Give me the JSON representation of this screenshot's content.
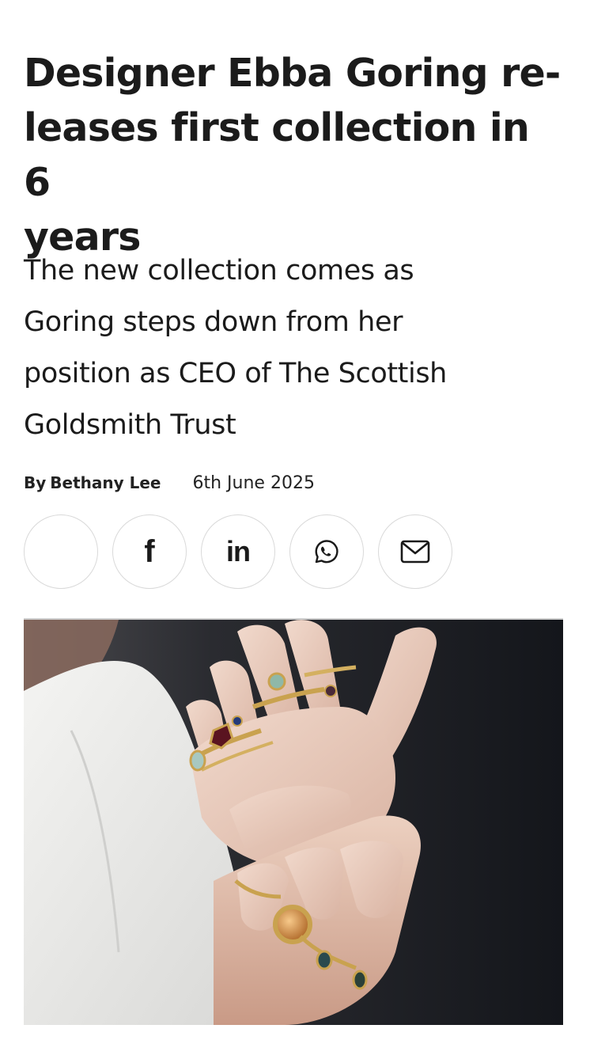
{
  "article": {
    "headline": "Designer Ebba Goring re-leases first collection in 6 years",
    "headline_lines": [
      "Designer Ebba Goring re-",
      "leases first collection in 6",
      "years"
    ],
    "standfirst_lines": [
      "The new collection comes as",
      "Goring steps down from her",
      "position as CEO of The Scottish",
      "Goldsmith Trust"
    ],
    "byline": {
      "prefix": "By",
      "author": "Bethany Lee",
      "date": "6th June 2025"
    }
  },
  "share": {
    "buttons": [
      {
        "icon": "x-twitter-icon"
      },
      {
        "icon": "facebook-icon",
        "glyph": "f"
      },
      {
        "icon": "linkedin-icon",
        "glyph": "in"
      },
      {
        "icon": "whatsapp-icon"
      },
      {
        "icon": "email-icon"
      }
    ]
  },
  "hero_image": {
    "subject": "hands wearing gemstone rings"
  },
  "colors": {
    "text": "#1b1b1b",
    "button_border": "#d9d9d9",
    "image_background": "#1a1c22"
  }
}
